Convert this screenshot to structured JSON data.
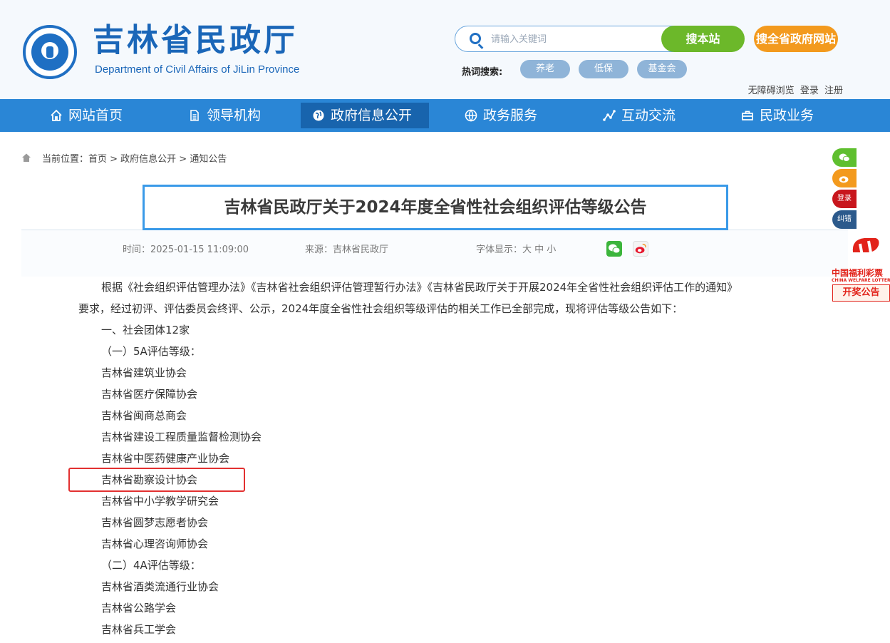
{
  "header": {
    "title": "吉林省民政厅",
    "subtitle": "Department of Civil Affairs of JiLin Province",
    "search_placeholder": "请输入关键词",
    "search_site_label": "搜本站",
    "search_province_label": "搜全省政府网站",
    "hot_label": "热词搜索:",
    "hot_tags": [
      "养老",
      "低保",
      "基金会"
    ],
    "top_links": [
      "无障碍浏览",
      "登录",
      "注册"
    ]
  },
  "nav": {
    "items": [
      {
        "label": "网站首页",
        "icon": "home-icon"
      },
      {
        "label": "领导机构",
        "icon": "document-icon"
      },
      {
        "label": "政府信息公开",
        "icon": "globe-icon"
      },
      {
        "label": "政务服务",
        "icon": "globe-grid-icon"
      },
      {
        "label": "互动交流",
        "icon": "chart-line-icon"
      },
      {
        "label": "民政业务",
        "icon": "briefcase-icon"
      }
    ],
    "active_index": 2
  },
  "breadcrumb": "当前位置：首页 > 政府信息公开 > 通知公告",
  "article": {
    "title": "吉林省民政厅关于2024年度全省性社会组织评估等级公告",
    "time": "时间：2025-01-15 11:09:00",
    "source": "来源：吉林省民政厅",
    "font_size": "字体显示：大 中 小",
    "intro_1": "根据《社会组织评估管理办法》《吉林省社会组织评估管理暂行办法》《吉林省民政厅关于开展2024年全省性社会组织评估工作的通知》",
    "intro_2": "要求，经过初评、评估委员会终评、公示，2024年度全省性社会组织等级评估的相关工作已全部完成，现将评估等级公告如下：",
    "section_1": "一、社会团体12家",
    "sub_5a": "（一）5A评估等级：",
    "list_5a": [
      "吉林省建筑业协会",
      "吉林省医疗保障协会",
      "吉林省闽商总商会",
      "吉林省建设工程质量监督检测协会",
      "吉林省中医药健康产业协会",
      "吉林省勘察设计协会",
      "吉林省中小学教学研究会",
      "吉林省圆梦志愿者协会",
      "吉林省心理咨询师协会"
    ],
    "sub_4a": "（二）4A评估等级：",
    "list_4a": [
      "吉林省酒类流通行业协会",
      "吉林省公路学会",
      "吉林省兵工学会"
    ]
  },
  "float": {
    "login": "登录",
    "correction": "纠错",
    "lottery_name": "中国福利彩票",
    "lottery_en": "CHINA WELFARE LOTTERY",
    "lottery_btn": "开奖公告"
  },
  "colors": {
    "brand_blue": "#1a66b8",
    "nav_blue": "#2a86d6",
    "nav_active": "#1864ad",
    "green": "#6cb82a",
    "orange": "#f39a1e",
    "highlight_red": "#e23030"
  }
}
